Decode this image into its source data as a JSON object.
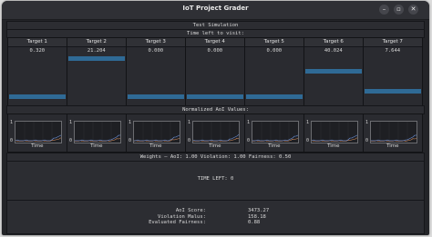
{
  "window": {
    "title": "IoT Project Grader"
  },
  "header": {
    "simulation": "Test Simulation",
    "time_left_label": "Time left to visit:"
  },
  "targets": [
    {
      "name": "Target 1",
      "value": "0.320",
      "level": 0.08
    },
    {
      "name": "Target 2",
      "value": "21.204",
      "level": 0.78
    },
    {
      "name": "Target 3",
      "value": "0.000",
      "level": 0.08
    },
    {
      "name": "Target 4",
      "value": "0.000",
      "level": 0.08
    },
    {
      "name": "Target 5",
      "value": "0.000",
      "level": 0.08
    },
    {
      "name": "Target 6",
      "value": "40.024",
      "level": 0.55
    },
    {
      "name": "Target 7",
      "value": "7.644",
      "level": 0.18
    }
  ],
  "aoi": {
    "label": "Normalized AoI Values:",
    "y_top": "1",
    "y_bottom": "0",
    "x_label": "Time",
    "series_colors": [
      "#d08a5a",
      "#6a8fd6"
    ]
  },
  "weights": {
    "text": "Weights – AoI: 1.00   Violation: 1.00   Fairness: 0.50"
  },
  "time_left": {
    "text": "TIME LEFT: 0"
  },
  "scores": [
    {
      "label": "AoI Score:",
      "value": "3473.27"
    },
    {
      "label": "Violation Malus:",
      "value": "158.18"
    },
    {
      "label": "Evaluated Fairness:",
      "value": "0.88"
    }
  ]
}
